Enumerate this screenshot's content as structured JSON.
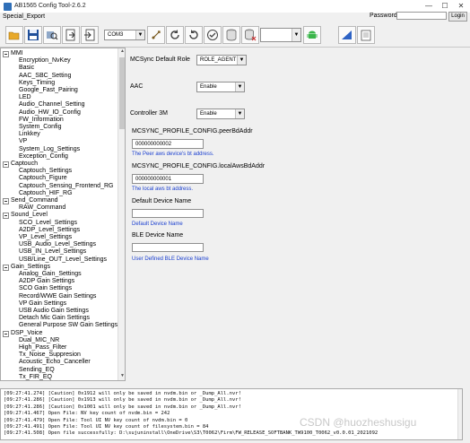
{
  "window": {
    "title": "AB1565 Config Tool-2.6.2",
    "minimize": "—",
    "maximize": "☐",
    "close": "✕"
  },
  "menu": {
    "special_export": "Special_Export"
  },
  "login": {
    "password_label": "Password:",
    "password_value": "",
    "login_label": "Login"
  },
  "toolbar": {
    "port": "COM3",
    "blank_select": "",
    "icons": [
      "open-folder-icon",
      "save-icon",
      "search-device-icon",
      "read-icon",
      "write-icon",
      "port-select",
      "usb-icon",
      "refresh-icon",
      "reload-icon",
      "check-icon",
      "database-icon",
      "database-delete-icon",
      "device-select",
      "android-icon",
      "upload-icon",
      "clipboard-icon"
    ]
  },
  "tree": [
    {
      "label": "MMI",
      "root": true
    },
    {
      "label": "Encryption_NvKey"
    },
    {
      "label": "Basic"
    },
    {
      "label": "AAC_SBC_Setting"
    },
    {
      "label": "Keys_Timing"
    },
    {
      "label": "Google_Fast_Pairing"
    },
    {
      "label": "LED"
    },
    {
      "label": "Audio_Channel_Setting"
    },
    {
      "label": "Audio_HW_IO_Config"
    },
    {
      "label": "FW_Information"
    },
    {
      "label": "System_Config"
    },
    {
      "label": "Linkkey"
    },
    {
      "label": "VP"
    },
    {
      "label": "System_Log_Settings"
    },
    {
      "label": "Exception_Config"
    },
    {
      "label": "Captouch",
      "root": true
    },
    {
      "label": "Captouch_Settings"
    },
    {
      "label": "Captouch_Figure"
    },
    {
      "label": "Captouch_Sensing_Frontend_RG"
    },
    {
      "label": "Captouch_HIF_RG"
    },
    {
      "label": "Send_Command",
      "root": true
    },
    {
      "label": "RAW_Command"
    },
    {
      "label": "Sound_Level",
      "root": true
    },
    {
      "label": "SCO_Level_Settings"
    },
    {
      "label": "A2DP_Level_Settings"
    },
    {
      "label": "VP_Level_Settings"
    },
    {
      "label": "USB_Audio_Level_Settings"
    },
    {
      "label": "USB_IN_Level_Settings"
    },
    {
      "label": "USB/Line_OUT_Level_Settings"
    },
    {
      "label": "Gain_Settings",
      "root": true
    },
    {
      "label": "Analog_Gain_Settings"
    },
    {
      "label": "A2DP Gain Settings"
    },
    {
      "label": "SCO Gain Settings"
    },
    {
      "label": "Record/WWE Gain Settings"
    },
    {
      "label": "VP Gain Settings"
    },
    {
      "label": "USB Audio Gain Settings"
    },
    {
      "label": "Detach Mic Gain Settings"
    },
    {
      "label": "General Purpose SW Gain Settings"
    },
    {
      "label": "DSP_Voice",
      "root": true
    },
    {
      "label": "Dual_MIC_NR"
    },
    {
      "label": "High_Pass_Filter"
    },
    {
      "label": "Tx_Noise_Suppresion"
    },
    {
      "label": "Acoustic_Echo_Canceller"
    },
    {
      "label": "Sending_EQ"
    },
    {
      "label": "Tx_FIR_EQ"
    }
  ],
  "form": {
    "role_label": "MCSync Default Role",
    "role_value": "ROLE_AGENT",
    "aac_label": "AAC",
    "aac_value": "Enable",
    "controller_label": "Controller 3M",
    "controller_value": "Enable",
    "peer_label": "MCSYNC_PROFILE_CONFIG.peerBdAddr",
    "peer_value": "000000000002",
    "peer_hint": "The Peer aws device's bt address.",
    "local_label": "MCSYNC_PROFILE_CONFIG.localAwsBdAddr",
    "local_value": "000000000001",
    "local_hint": "The local aws bt address.",
    "default_name_label": "Default Device Name",
    "default_name_value": "",
    "default_name_hint": "Default Device Name",
    "ble_name_label": "BLE Device Name",
    "ble_name_value": "",
    "ble_name_hint": "User Defined BLE Device Name"
  },
  "log": [
    "[09:27:41.274] [Caution] 0x1912 will only be saved in nvdm.bin or _Dump_All.nvr!",
    "[09:27:41.286] [Caution] 0x1913 will only be saved in nvdm.bin or _Dump_All.nvr!",
    "[09:27:41.286] [Caution] 0x1001 will only be saved in nvdm.bin or _Dump_All.nvr!",
    "[09:27:41.467] Open File: NV key count of nvdm.bin = 242",
    "[09:27:41.479] Open File: Tool UI NV key count of nvdm.bin = 0",
    "[09:27:41.491] Open File: Tool UI NV key count of filesystem.bin = 84",
    "[09:27:41.508] Open file successfully: D:\\sujuninstall\\OneDrive\\S3\\T0062\\Firm\\FW_RELEASE_SOFTBANK_TW9100_T0062_v0.0.01_2021092"
  ],
  "watermark": "CSDN @huozheshusigu"
}
